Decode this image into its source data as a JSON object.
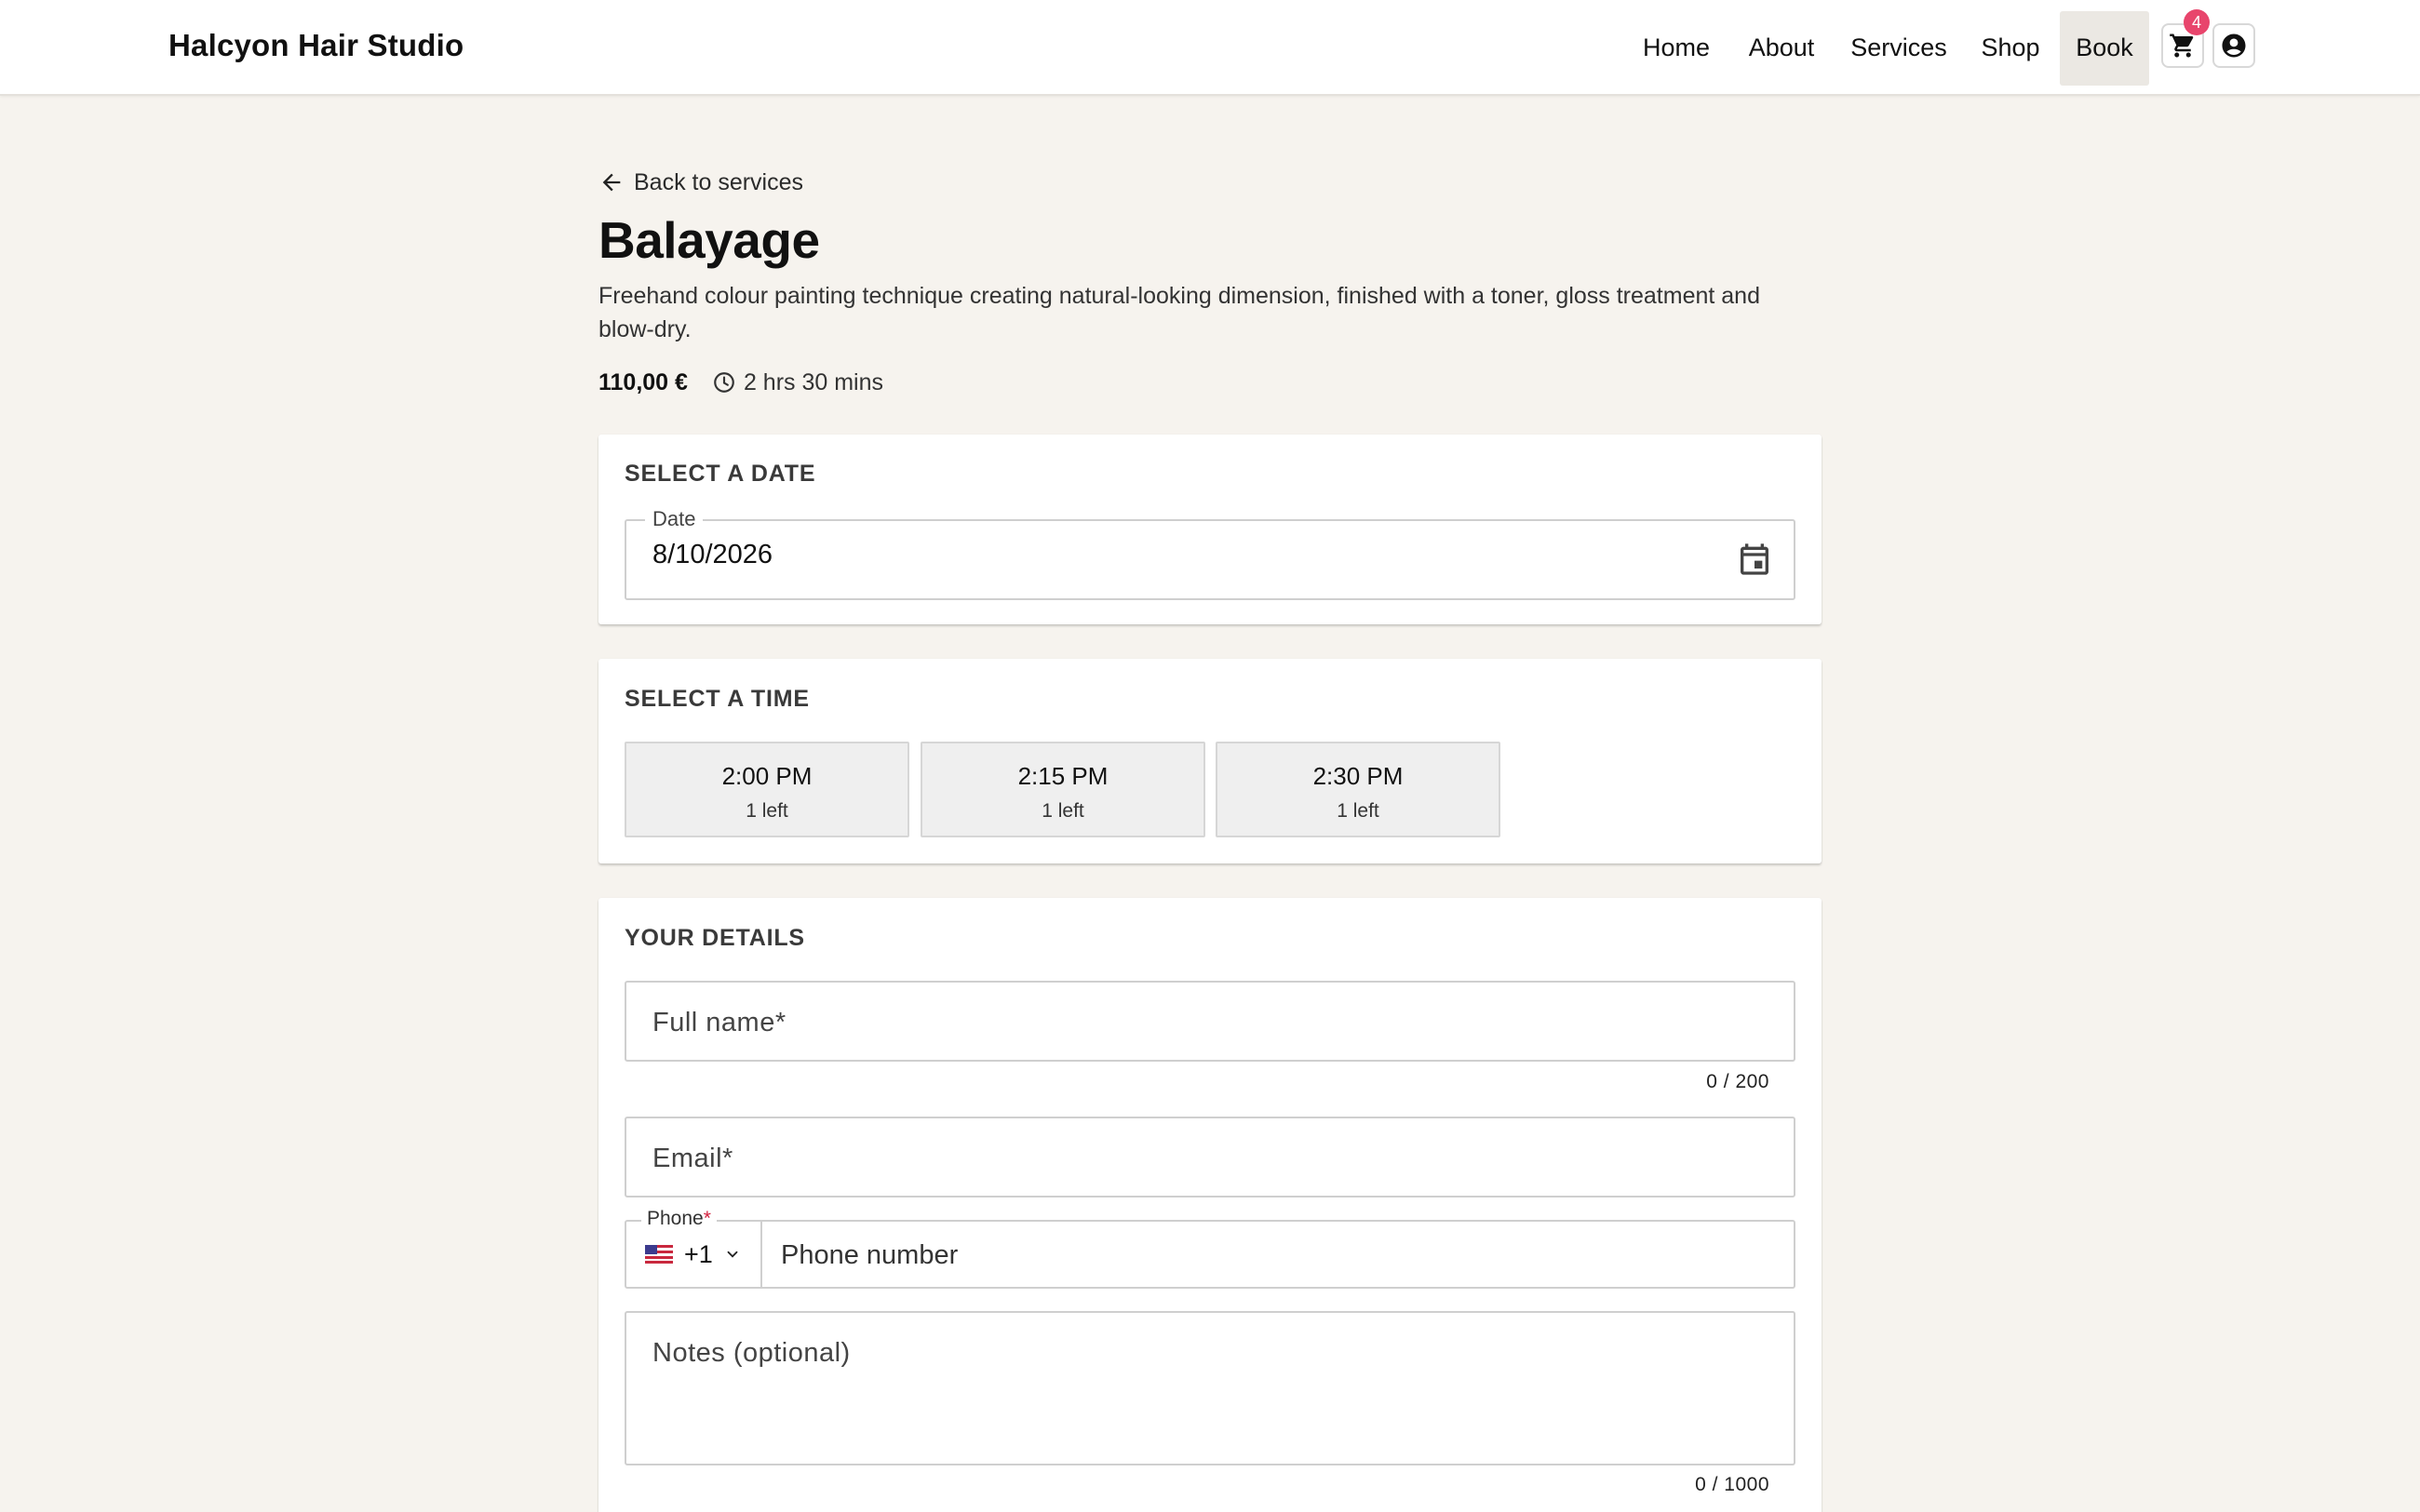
{
  "header": {
    "brand": "Halcyon Hair Studio",
    "nav": [
      "Home",
      "About",
      "Services",
      "Shop",
      "Book"
    ],
    "active_nav": "Book",
    "cart_count": "4",
    "icons": [
      "cart-icon",
      "account-icon"
    ]
  },
  "service": {
    "back_label": "Back to services",
    "title": "Balayage",
    "description": "Freehand colour painting technique creating natural-looking dimension, finished with a toner, gloss treatment and blow-dry.",
    "price": "110,00 €",
    "duration": "2 hrs 30 mins"
  },
  "date_section": {
    "heading": "Select a date",
    "field_label": "Date",
    "value": "8/10/2026"
  },
  "time_section": {
    "heading": "Select a time",
    "slots": [
      {
        "time": "2:00 PM",
        "availability": "1 left"
      },
      {
        "time": "2:15 PM",
        "availability": "1 left"
      },
      {
        "time": "2:30 PM",
        "availability": "1 left"
      }
    ]
  },
  "details_section": {
    "heading": "Your details",
    "full_name_placeholder": "Full name*",
    "full_name_counter": "0 / 200",
    "email_placeholder": "Email*",
    "phone_label": "Phone",
    "phone_required_mark": "*",
    "country_code": "+1",
    "phone_placeholder": "Phone number",
    "notes_placeholder": "Notes (optional)",
    "notes_counter": "0 / 1000"
  },
  "colors": {
    "page_bg": "#f6f3ee",
    "badge": "#e8456c",
    "active_nav_bg": "#ebe8e3",
    "required": "#d21f3c"
  }
}
